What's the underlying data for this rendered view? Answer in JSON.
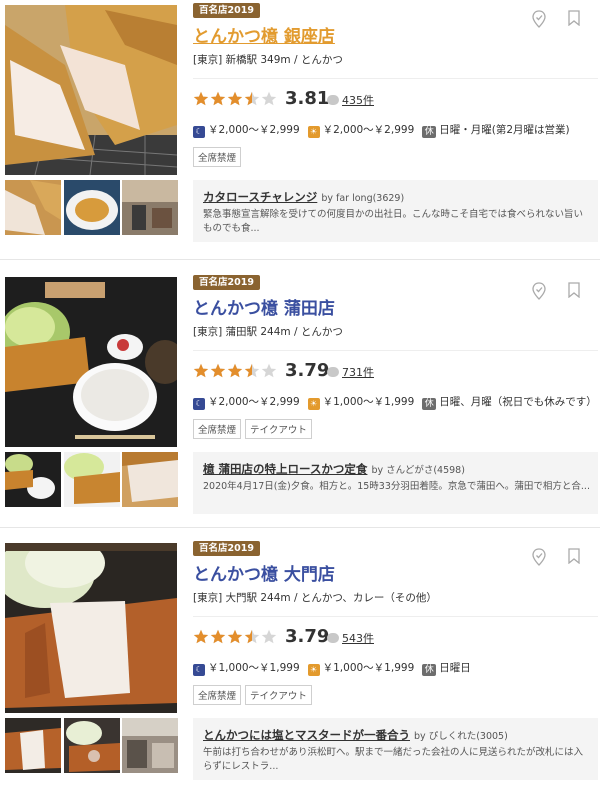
{
  "restaurants": [
    {
      "badge": "百名店2019",
      "name": "とんかつ檍 銀座店",
      "area": "[東京] 新橋駅 349m / とんかつ",
      "score": "3.81",
      "stars": 3.5,
      "review_count": "435件",
      "dinner_budget": "￥2,000～￥2,999",
      "lunch_budget": "￥2,000～￥2,999",
      "holiday_label": "休",
      "holiday": "日曜・月曜(第2月曜は営業)",
      "tags": [
        "全席禁煙"
      ],
      "review_title": "カタロースチャレンジ",
      "review_author": "by far long(3629)",
      "review_body": "緊急事態宣言解除を受けての何度目かの出社日。こんな時こそ自宅では食べられない旨いものでも食..."
    },
    {
      "badge": "百名店2019",
      "name": "とんかつ檍 蒲田店",
      "area": "[東京] 蒲田駅 244m / とんかつ",
      "score": "3.79",
      "stars": 3.5,
      "review_count": "731件",
      "dinner_budget": "￥2,000～￥2,999",
      "lunch_budget": "￥1,000～￥1,999",
      "holiday_label": "休",
      "holiday": "日曜、月曜（祝日でも休みです）",
      "tags": [
        "全席禁煙",
        "テイクアウト"
      ],
      "review_title": "檍 蒲田店の特上ロースかつ定食",
      "review_author": "by さんどがさ(4598)",
      "review_body": "2020年4月17日(金)夕食。相方と。15時33分羽田着陸。京急で蒲田へ。蒲田で相方と合..."
    },
    {
      "badge": "百名店2019",
      "name": "とんかつ檍 大門店",
      "area": "[東京] 大門駅 244m / とんかつ、カレー（その他）",
      "score": "3.79",
      "stars": 3.5,
      "review_count": "543件",
      "dinner_budget": "￥1,000～￥1,999",
      "lunch_budget": "￥1,000～￥1,999",
      "holiday_label": "休",
      "holiday": "日曜日",
      "tags": [
        "全席禁煙",
        "テイクアウト"
      ],
      "review_title": "とんかつには塩とマスタードが一番合う",
      "review_author": "by ぴしくれた(3005)",
      "review_body": "午前は打ち合わせがあり浜松町へ。駅まで一緒だった会社の人に見送られたが改札には入らずにレストラ..."
    }
  ],
  "icons": {
    "dinner": "moon-icon",
    "lunch": "sun-icon",
    "bookmark": "bookmark-icon",
    "pin": "map-pin-icon"
  },
  "colors": {
    "name": "#3a4fa0",
    "name_hover": "#e29b2f",
    "star": "#e38e2c",
    "badge": "#8a6330",
    "dinner": "#364a94",
    "lunch": "#e39a2d"
  }
}
